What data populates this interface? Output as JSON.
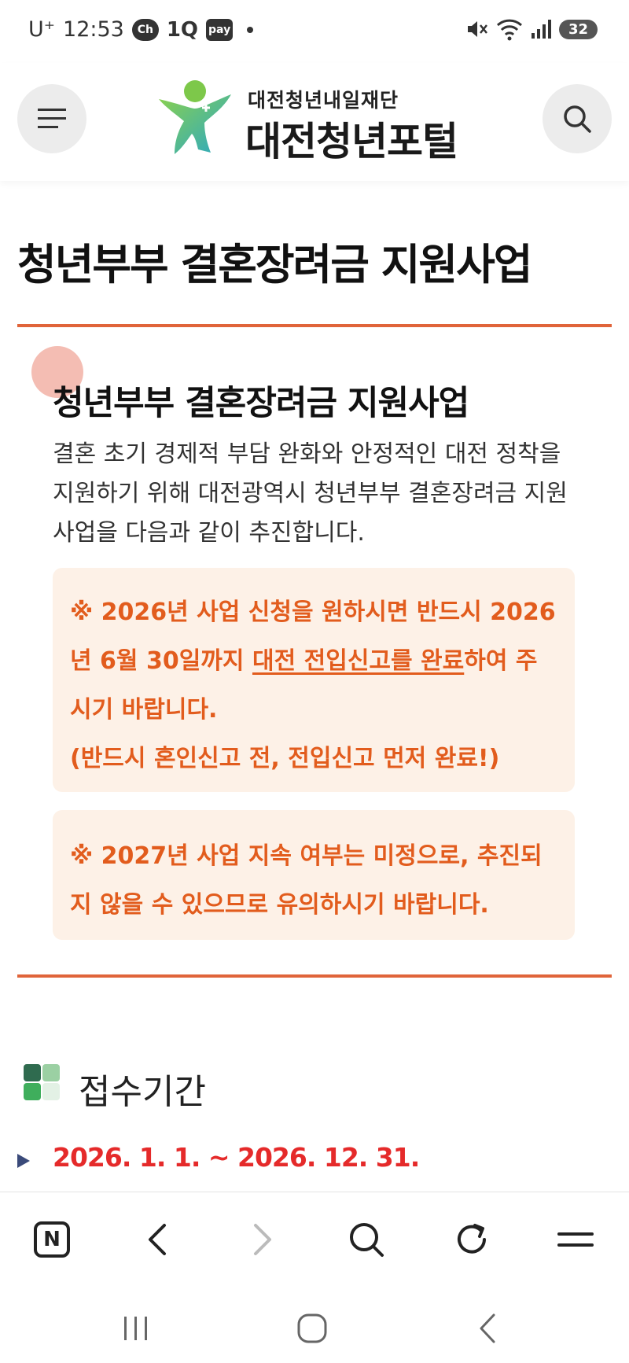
{
  "status_bar": {
    "carrier": "U⁺",
    "time": "12:53",
    "app_icons": [
      "Ch",
      "1Q",
      "pay"
    ],
    "battery": "32",
    "icon_names": [
      "mute-icon",
      "wifi-icon",
      "signal-icon",
      "battery-icon"
    ]
  },
  "header": {
    "logo_subtitle": "대전청년내일재단",
    "logo_title": "대전청년포털",
    "menu_icon": "hamburger-menu-icon",
    "search_icon": "search-icon"
  },
  "page": {
    "title": "청년부부 결혼장려금 지원사업",
    "section_heading": "청년부부 결혼장려금 지원사업",
    "intro": "결혼 초기 경제적 부담 완화와 안정적인 대전 정착을 지원하기 위해 대전광역시 청년부부 결혼장려금 지원사업을 다음과 같이 추진합니다.",
    "notice1": {
      "part1": "※ 2026년 사업 신청을 원하시면 반드시 2026년 6월 30일까지 ",
      "underlined": "대전 전입신고를 완료",
      "part2": "하여 주시기 바랍니다.",
      "line2": "(반드시 혼인신고 전, 전입신고 먼저 완료!)"
    },
    "notice2": "※ 2027년 사업 지속 여부는 미정으로, 추진되지 않을 수 있으므로 유의하시기 바랍니다.",
    "reception_heading": "접수기간",
    "reception_period": "2026. 1. 1. ~ 2026. 12. 31."
  },
  "browser_toolbar": {
    "home_label": "N",
    "icon_names": [
      "naver-home-icon",
      "back-icon",
      "forward-icon",
      "search-icon",
      "reload-icon",
      "menu-icon"
    ]
  },
  "system_nav": {
    "icon_names": [
      "recent-apps-icon",
      "home-icon",
      "back-icon"
    ]
  },
  "colors": {
    "accent": "#e0643a",
    "notice_text": "#e25c1d",
    "notice_bg": "#fdf1e7",
    "period_text": "#e52a2a",
    "logo_green": "#4cbf6a",
    "logo_teal": "#29a7c6"
  }
}
